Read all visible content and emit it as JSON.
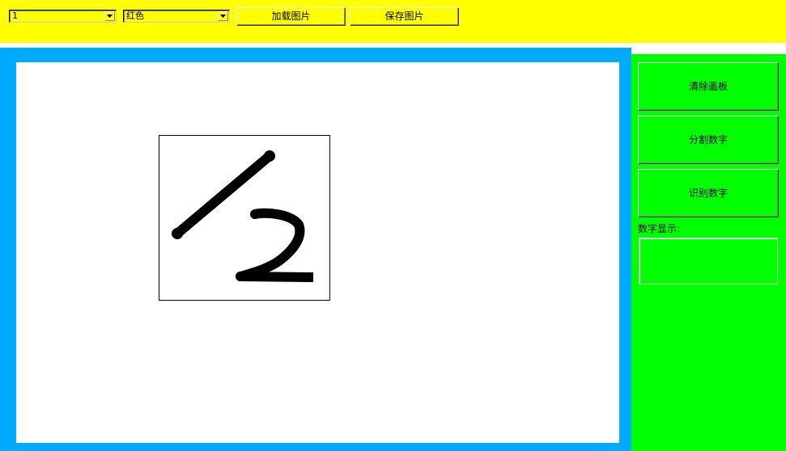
{
  "toolbar": {
    "brush_size_select": {
      "value": "1"
    },
    "color_select": {
      "value": "红色"
    },
    "load_button_label": "加载图片",
    "save_button_label": "保存图片"
  },
  "sidebar": {
    "clear_button_label": "清除画板",
    "segment_button_label": "分割数字",
    "recognize_button_label": "识别数字",
    "result_label": "数字显示:",
    "result_value": ""
  },
  "colors": {
    "toolbar_bg": "#ffff00",
    "canvas_frame": "#00aaff",
    "canvas_bg": "#ffffff",
    "sidebar_bg": "#00ff00",
    "stroke": "#000000"
  }
}
